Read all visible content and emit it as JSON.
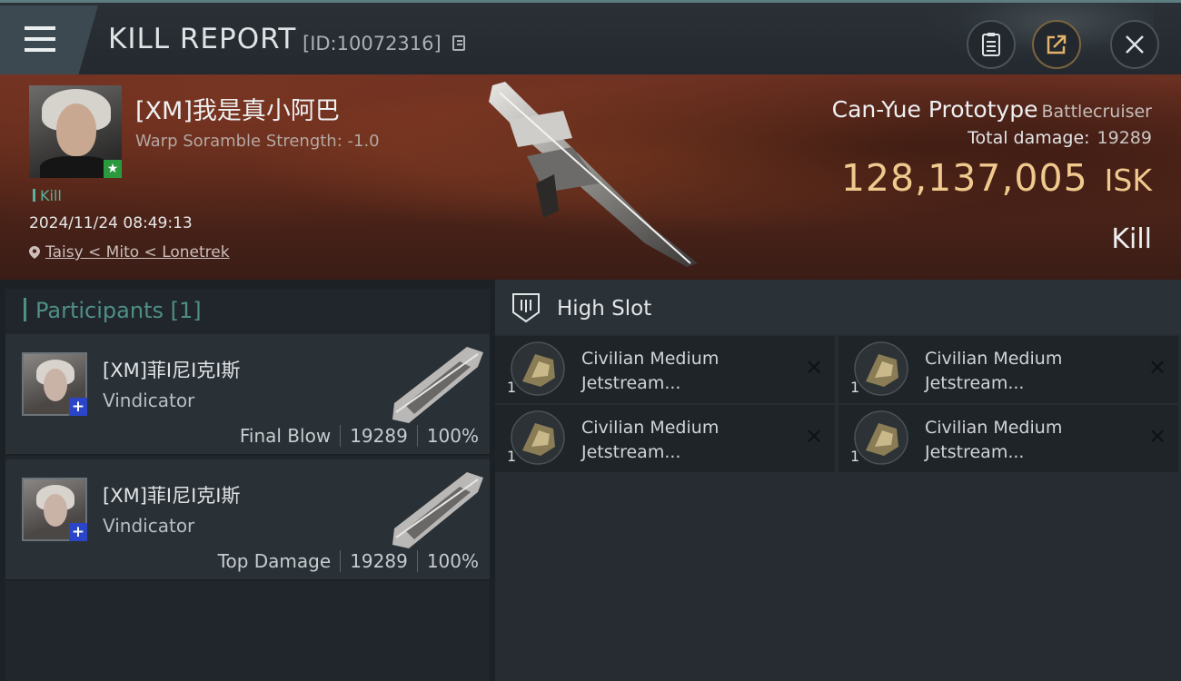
{
  "header": {
    "title": "KILL REPORT",
    "report_id": "[ID:10072316]",
    "icons": [
      "menu-icon",
      "copy-icon",
      "clipboard-icon",
      "share-icon",
      "close-icon"
    ]
  },
  "victim": {
    "name": "[XM]我是真小阿巴",
    "warp_scramble": "Warp Soramble Strength: -1.0",
    "tag": "Kill",
    "datetime": "2024/11/24 08:49:13",
    "location": "Taisy < Mito < Lonetrek",
    "ship_name": "Can-Yue Prototype",
    "ship_class": "Battlecruiser",
    "total_damage_label": "Total damage:",
    "total_damage": "19289",
    "isk_amount": "128,137,005",
    "isk_unit": "ISK",
    "result": "Kill"
  },
  "participants": {
    "title": "Participants [1]",
    "items": [
      {
        "name": "[XM]菲I尼I克I斯",
        "ship": "Vindicator",
        "role": "Final Blow",
        "damage": "19289",
        "percent": "100%"
      },
      {
        "name": "[XM]菲I尼I克I斯",
        "ship": "Vindicator",
        "role": "Top Damage",
        "damage": "19289",
        "percent": "100%"
      }
    ]
  },
  "high_slot": {
    "title": "High Slot",
    "modules": [
      {
        "line1": "Civilian Medium",
        "line2": "Jetstream...",
        "qty": "1"
      },
      {
        "line1": "Civilian Medium",
        "line2": "Jetstream...",
        "qty": "1"
      },
      {
        "line1": "Civilian Medium",
        "line2": "Jetstream...",
        "qty": "1"
      },
      {
        "line1": "Civilian Medium",
        "line2": "Jetstream...",
        "qty": "1"
      }
    ]
  },
  "colors": {
    "isk": "#f0c98e",
    "kill_tag": "#58b39c",
    "participants_head": "#4f8f86",
    "banner": "#4f2419",
    "plus_badge": "#2a45c7",
    "star_badge": "#2b9a3f"
  }
}
